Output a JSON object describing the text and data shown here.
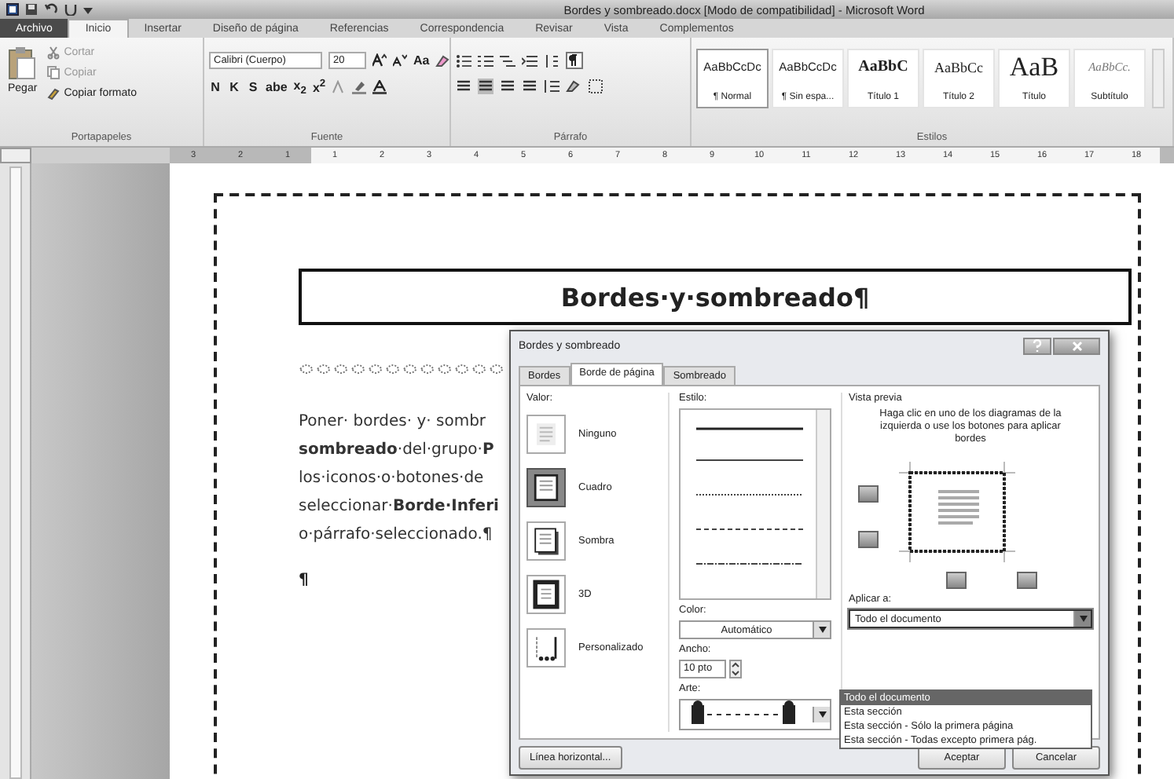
{
  "window": {
    "title": "Bordes y sombreado.docx [Modo de compatibilidad] - Microsoft Word"
  },
  "tabs": [
    {
      "label": "Archivo",
      "kind": "file",
      "selected": false
    },
    {
      "label": "Inicio",
      "kind": "tab",
      "selected": true
    },
    {
      "label": "Insertar",
      "kind": "tab",
      "selected": false
    },
    {
      "label": "Diseño de página",
      "kind": "tab",
      "selected": false
    },
    {
      "label": "Referencias",
      "kind": "tab",
      "selected": false
    },
    {
      "label": "Correspondencia",
      "kind": "tab",
      "selected": false
    },
    {
      "label": "Revisar",
      "kind": "tab",
      "selected": false
    },
    {
      "label": "Vista",
      "kind": "tab",
      "selected": false
    },
    {
      "label": "Complementos",
      "kind": "tab",
      "selected": false
    }
  ],
  "clipboard": {
    "paste": "Pegar",
    "actions": [
      {
        "label": "Cortar",
        "disabled": true
      },
      {
        "label": "Copiar",
        "disabled": true
      },
      {
        "label": "Copiar formato",
        "disabled": false
      }
    ],
    "label": "Portapapeles"
  },
  "font": {
    "name": "Calibri (Cuerpo)",
    "size": "20",
    "case_button": "Aa",
    "format_buttons": [
      "N",
      "K",
      "S",
      "abe",
      "x$_{2}$",
      "x$^{2}$"
    ],
    "label": "Fuente"
  },
  "paragraph": {
    "label": "Párrafo"
  },
  "styles": {
    "label": "Estilos",
    "items": [
      {
        "preview": "AaBbCcDc",
        "name": "¶ Normal",
        "kind": "normal",
        "selected": true
      },
      {
        "preview": "AaBbCcDc",
        "name": "¶ Sin espa...",
        "kind": "normal",
        "selected": false
      },
      {
        "preview": "AaBbC",
        "name": "Título 1",
        "kind": "heading1",
        "selected": false
      },
      {
        "preview": "AaBbCc",
        "name": "Título 2",
        "kind": "heading2",
        "selected": false
      },
      {
        "preview": "AaB",
        "name": "Título",
        "kind": "title",
        "selected": false
      },
      {
        "preview": "AaBbCc.",
        "name": "Subtítulo",
        "kind": "subtitle",
        "selected": false
      }
    ]
  },
  "ruler": {
    "left_numbers": [
      "3",
      "2",
      "1"
    ],
    "numbers": [
      "1",
      "2",
      "3",
      "4",
      "5",
      "6",
      "7",
      "8",
      "9",
      "10",
      "11",
      "12",
      "13",
      "14",
      "15",
      "16",
      "17",
      "18"
    ]
  },
  "document": {
    "heading": "Bordes·y·sombreado¶",
    "lines": [
      "Poner· bordes· y· sombr",
      "**sombreado**·del·grupo·**P**",
      "los·iconos·o·botones·de",
      "seleccionar·**Borde·Inferi**",
      "o·párrafo·seleccionado.¶"
    ],
    "empty_paragraph": "¶"
  },
  "dialog": {
    "title": "Bordes y sombreado",
    "tabs": [
      {
        "label": "Bordes",
        "selected": false
      },
      {
        "label": "Borde de página",
        "selected": true
      },
      {
        "label": "Sombreado",
        "selected": false
      }
    ],
    "setting_label": "Valor:",
    "settings": [
      {
        "label": "Ninguno",
        "kind": "none",
        "selected": false
      },
      {
        "label": "Cuadro",
        "kind": "box",
        "selected": true
      },
      {
        "label": "Sombra",
        "kind": "shadow",
        "selected": false
      },
      {
        "label": "3D",
        "kind": "threed",
        "selected": false
      },
      {
        "label": "Personalizado",
        "kind": "custom",
        "selected": false
      }
    ],
    "style_label": "Estilo:",
    "color_label": "Color:",
    "color_value": "Automático",
    "width_label": "Ancho:",
    "width": "10 pto",
    "art_label": "Arte:",
    "preview_label": "Vista previa",
    "preview_hint": "Haga clic en uno de los diagramas de la izquierda o use los botones para aplicar bordes",
    "apply_label": "Aplicar a:",
    "apply_value": "Todo el documento",
    "apply_expanded": true,
    "apply_options": [
      {
        "label": "Todo el documento",
        "selected": true
      },
      {
        "label": "Esta sección",
        "selected": false
      },
      {
        "label": "Esta sección - Sólo la primera página",
        "selected": false
      },
      {
        "label": "Esta sección - Todas excepto primera pág.",
        "selected": false
      }
    ],
    "horizontal_line_button": "Línea horizontal...",
    "ok_button": "Aceptar",
    "cancel_button": "Cancelar"
  }
}
